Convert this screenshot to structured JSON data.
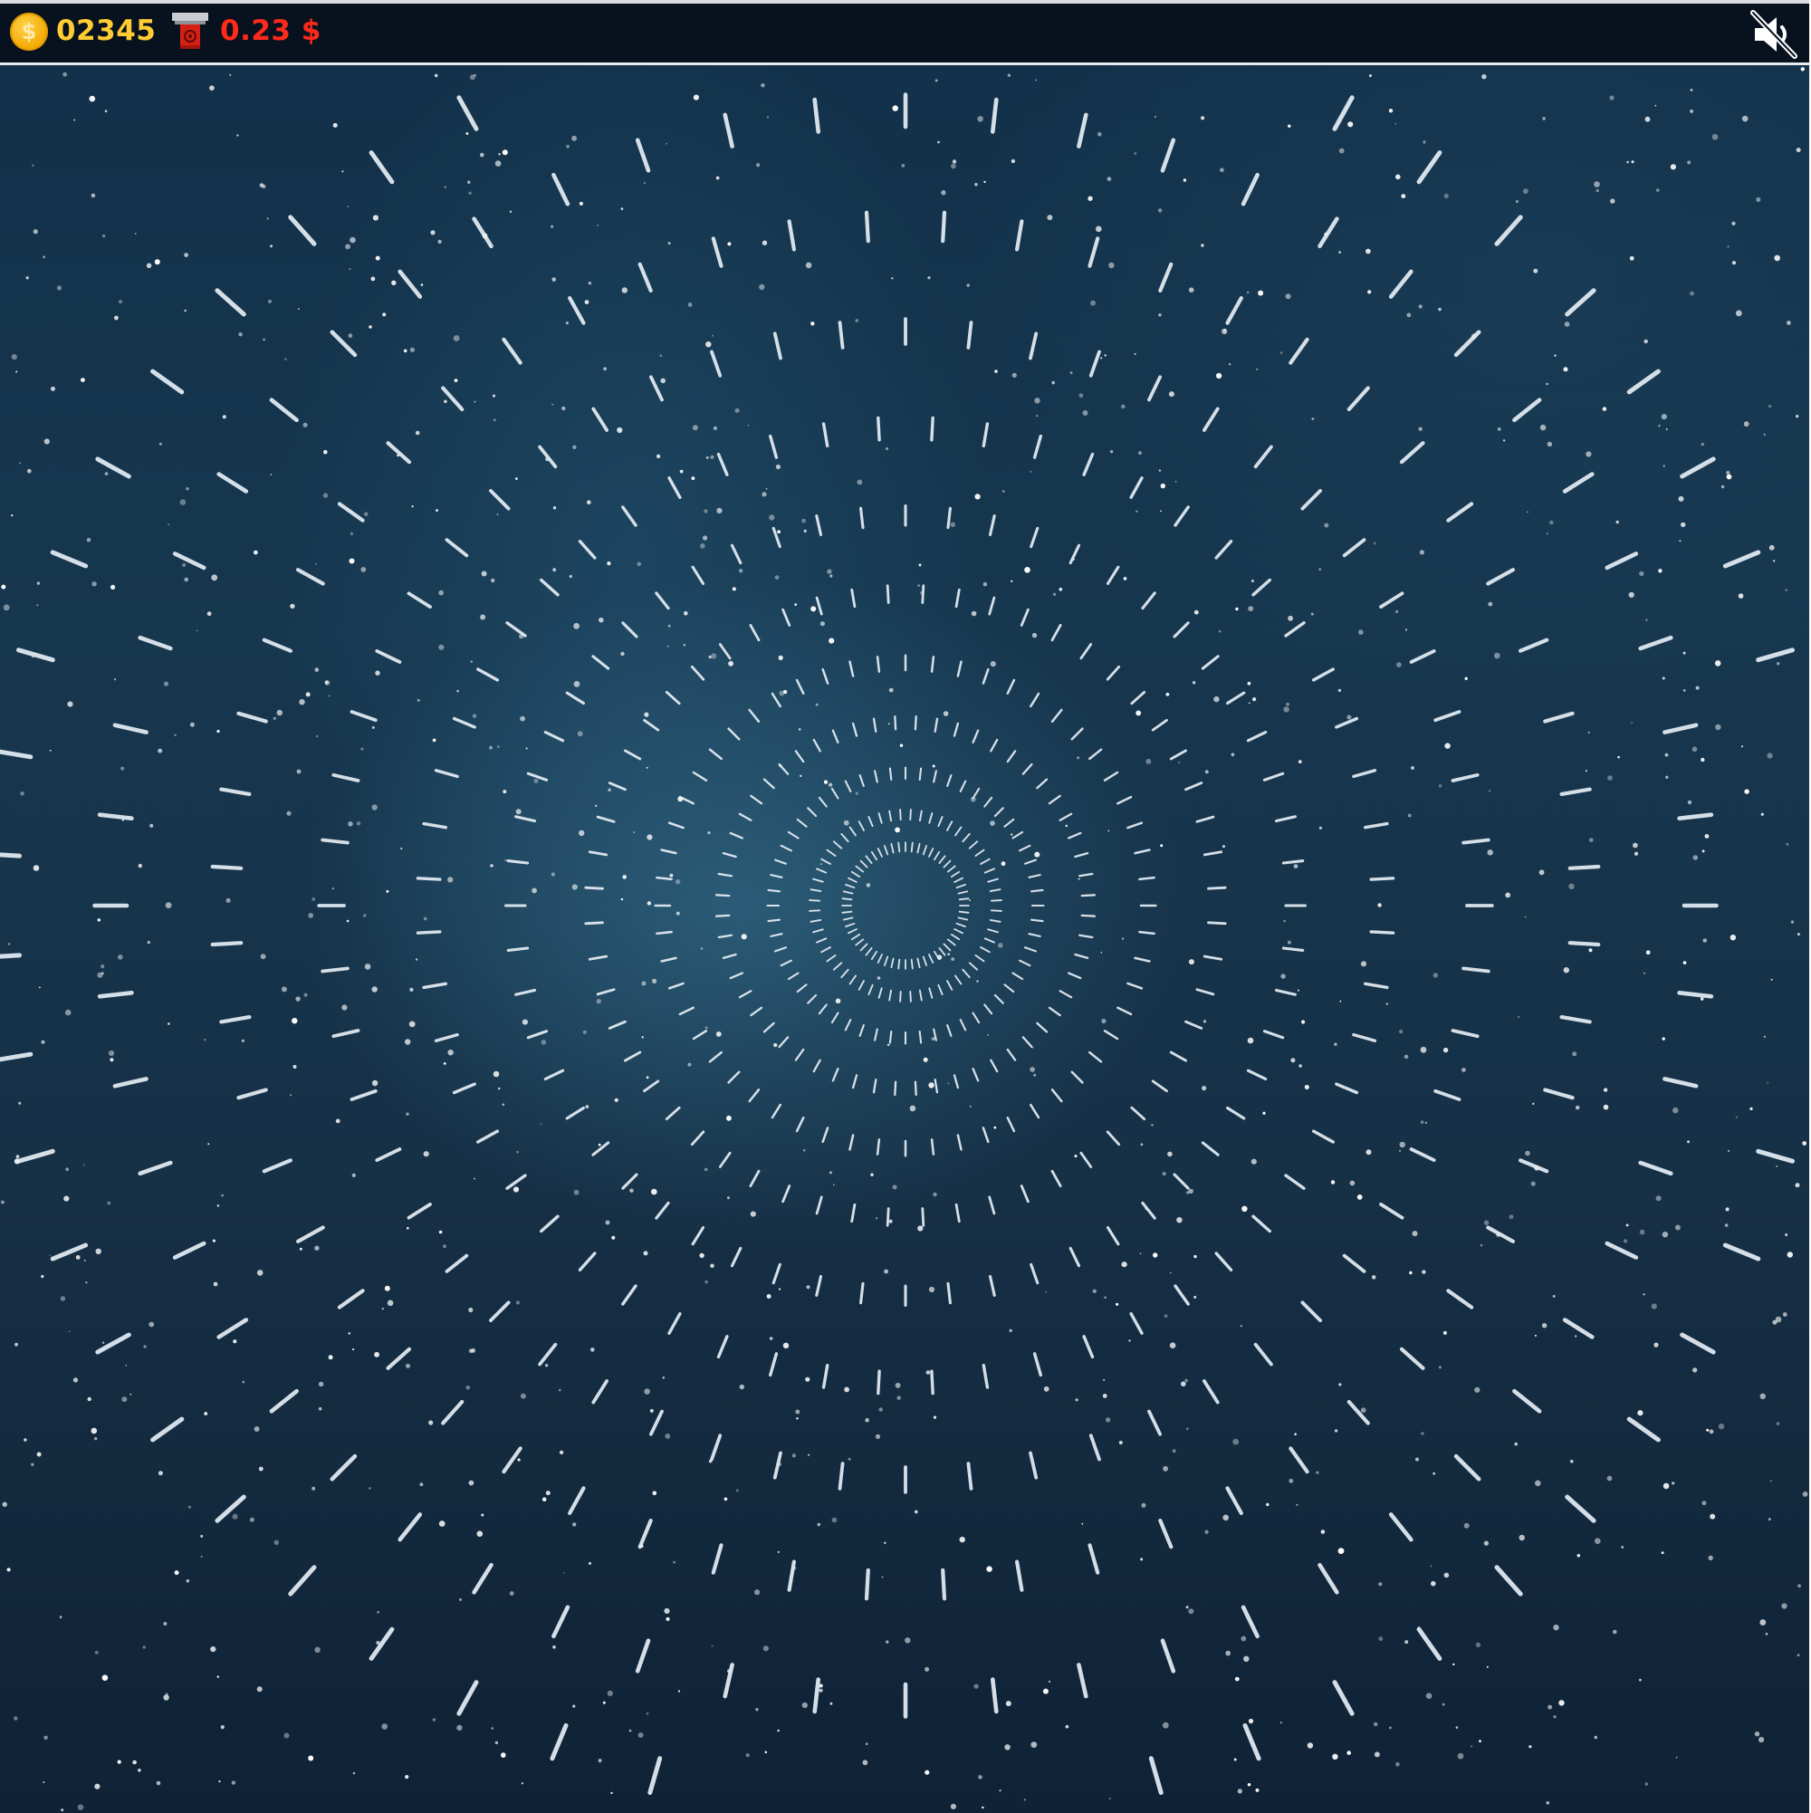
{
  "hud": {
    "coins": "02345",
    "money": "0.23 $",
    "coin_symbol": "$"
  },
  "icons": {
    "coin": "coin-icon",
    "withdraw": "atm-withdraw-icon",
    "sound": "speaker-muted-icon"
  },
  "colors": {
    "coins_text": "#ffcc33",
    "money_text": "#ff2a1a",
    "hud_bg": "#08111e",
    "space_bg": "#17374f"
  },
  "state": {
    "sound_muted": true
  }
}
